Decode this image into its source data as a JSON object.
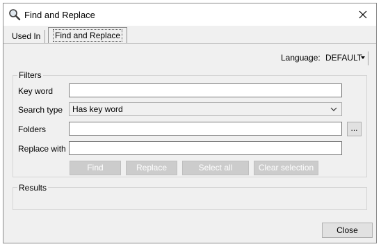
{
  "window": {
    "title": "Find and Replace"
  },
  "tabs": [
    {
      "label": "Used In"
    },
    {
      "label": "Find and Replace"
    }
  ],
  "language": {
    "label": "Language:",
    "value": "DEFAULT"
  },
  "filters": {
    "group_label": "Filters",
    "key_word": {
      "label": "Key word",
      "value": ""
    },
    "search_type": {
      "label": "Search type",
      "value": "Has key word"
    },
    "folders": {
      "label": "Folders",
      "value": "",
      "browse_label": "..."
    },
    "replace_with": {
      "label": "Replace with",
      "value": ""
    },
    "buttons": {
      "find": "Find",
      "replace": "Replace",
      "select_all": "Select all",
      "clear_selection": "Clear selection"
    }
  },
  "results": {
    "group_label": "Results"
  },
  "footer": {
    "close_label": "Close"
  }
}
